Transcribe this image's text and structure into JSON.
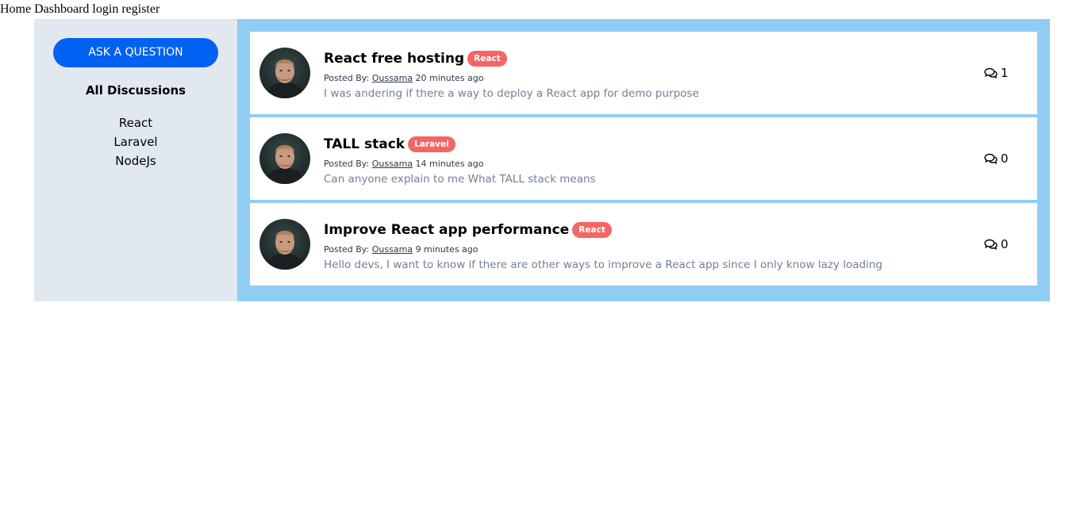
{
  "nav": {
    "home": "Home",
    "dashboard": "Dashboard",
    "login": "login",
    "register": "register"
  },
  "sidebar": {
    "ask_button": "ASK A QUESTION",
    "heading": "All Discussions",
    "categories": [
      "React",
      "Laravel",
      "NodeJs"
    ]
  },
  "posts": [
    {
      "title": "React free hosting",
      "tag": "React",
      "posted_by_label": "Posted By:",
      "author": "Oussama",
      "time": "20 minutes ago",
      "excerpt": "I was andering if there a way to deploy a React app for demo purpose",
      "comment_count": "1"
    },
    {
      "title": "TALL stack",
      "tag": "Laravel",
      "posted_by_label": "Posted By:",
      "author": "Oussama",
      "time": "14 minutes ago",
      "excerpt": "Can anyone explain to me What TALL stack means",
      "comment_count": "0"
    },
    {
      "title": "Improve React app performance",
      "tag": "React",
      "posted_by_label": "Posted By:",
      "author": "Oussama",
      "time": "9 minutes ago",
      "excerpt": "Hello devs, I want to know if there are other ways to improve a React app since I only know lazy loading",
      "comment_count": "0"
    }
  ],
  "colors": {
    "accent": "#0061f2",
    "badge": "#f56565",
    "sidebar_bg": "#e2e8f0",
    "main_bg": "#90cdf4"
  },
  "icons": {
    "comment": "comments-icon",
    "avatar": "user-avatar"
  }
}
